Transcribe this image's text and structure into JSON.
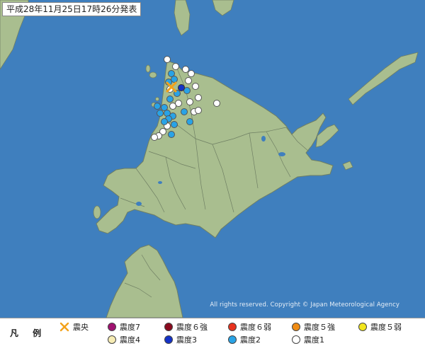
{
  "title": "平成28年11月25日17時26分発表",
  "copyright": "All rights reserved. Copyright © Japan Meteorological Agency",
  "legend": {
    "title": "凡 例",
    "items": [
      {
        "label": "震央",
        "icon": "x-mark-icon",
        "color": "#f3a21a"
      },
      {
        "label": "震度7",
        "icon": "circle",
        "color": "#a01170"
      },
      {
        "label": "震度６強",
        "icon": "circle",
        "color": "#8a0a1e"
      },
      {
        "label": "震度６弱",
        "icon": "circle",
        "color": "#e8321e"
      },
      {
        "label": "震度５強",
        "icon": "circle",
        "color": "#f08c14"
      },
      {
        "label": "震度５弱",
        "icon": "circle",
        "color": "#f2e61e"
      },
      {
        "label": "震度4",
        "icon": "circle",
        "color": "#f6ecb4"
      },
      {
        "label": "震度3",
        "icon": "circle",
        "color": "#1432c8"
      },
      {
        "label": "震度2",
        "icon": "circle",
        "color": "#29a3e6"
      },
      {
        "label": "震度1",
        "icon": "circle",
        "color": "#ffffff"
      }
    ]
  },
  "colors": {
    "sea": "#3f7fbe",
    "land": "#a9be8f",
    "border": "#6f7f63",
    "epicenter": "#f3a21a"
  },
  "intensity_points": {
    "shindo3": 1,
    "shindo2": 17,
    "shindo1": 19
  }
}
